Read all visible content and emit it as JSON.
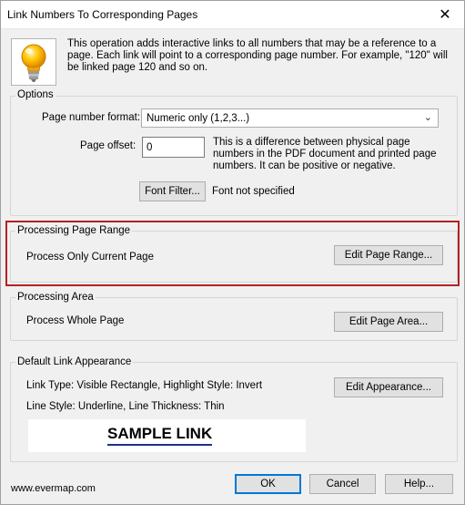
{
  "window": {
    "title": "Link Numbers To Corresponding Pages",
    "close_icon": "close-icon"
  },
  "intro": {
    "icon": "lightbulb-icon",
    "text": "This operation adds interactive links to all numbers that may be a reference to a page. Each link will point to a corresponding page number. For example, \"120\" will be linked page 120 and so on."
  },
  "options": {
    "group_label": "Options",
    "page_number_format_label": "Page number format:",
    "page_number_format_value": "Numeric only (1,2,3...)",
    "page_offset_label": "Page offset:",
    "page_offset_value": "0",
    "page_offset_help": "This is a difference between physical page numbers in the PDF document and printed page numbers. It can be positive or negative.",
    "font_filter_button": "Font Filter...",
    "font_status": "Font not specified"
  },
  "processing_page_range": {
    "group_label": "Processing Page Range",
    "value": "Process Only Current Page",
    "edit_button": "Edit Page Range..."
  },
  "processing_area": {
    "group_label": "Processing Area",
    "value": "Process Whole Page",
    "edit_button": "Edit Page Area..."
  },
  "default_link_appearance": {
    "group_label": "Default Link Appearance",
    "line1": "Link Type: Visible Rectangle, Highlight Style: Invert",
    "line2": "Line Style: Underline, Line Thickness: Thin",
    "edit_button": "Edit Appearance...",
    "sample_text": "SAMPLE LINK"
  },
  "footer": {
    "website": "www.evermap.com",
    "ok": "OK",
    "cancel": "Cancel",
    "help": "Help..."
  },
  "colors": {
    "highlight_border": "#b22222",
    "primary_button_border": "#0078d7",
    "sample_underline": "#1f2f8f"
  }
}
